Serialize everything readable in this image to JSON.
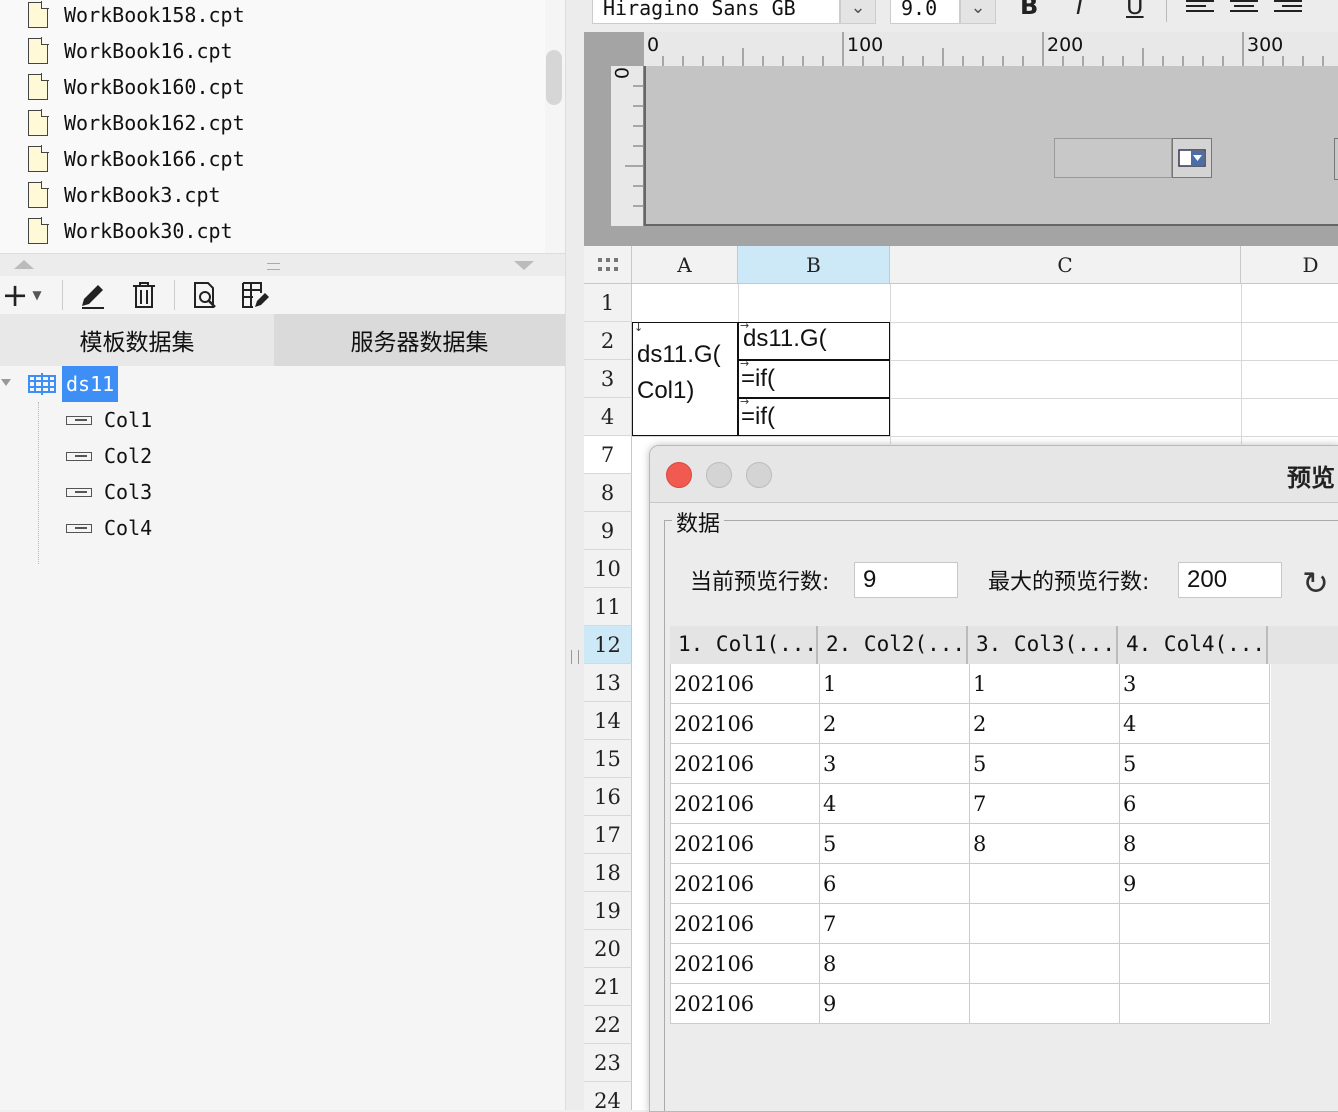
{
  "file_list": [
    "WorkBook158.cpt",
    "WorkBook16.cpt",
    "WorkBook160.cpt",
    "WorkBook162.cpt",
    "WorkBook166.cpt",
    "WorkBook3.cpt",
    "WorkBook30.cpt"
  ],
  "ds_tabs": {
    "template": "模板数据集",
    "server": "服务器数据集"
  },
  "tree": {
    "dataset": "ds11",
    "columns": [
      "Col1",
      "Col2",
      "Col3",
      "Col4"
    ]
  },
  "format_toolbar": {
    "font_name": "Hiragino Sans GB",
    "font_size": "9.0",
    "bold": "B",
    "italic": "I",
    "underline": "U"
  },
  "ruler": {
    "top": [
      "0",
      "100",
      "200",
      "300"
    ],
    "left": "0"
  },
  "sheet": {
    "columns": [
      "A",
      "B",
      "C",
      "D"
    ],
    "rows": [
      "1",
      "2",
      "3",
      "4",
      "7",
      "8",
      "9",
      "10",
      "11",
      "12",
      "13",
      "14",
      "15",
      "16",
      "17",
      "18",
      "19",
      "20",
      "21",
      "22",
      "23",
      "24"
    ],
    "cells": {
      "a2": "ds11.G(",
      "a2b": "Col1)",
      "b2": "ds11.G(",
      "b3": "=if(",
      "b4": "=if("
    }
  },
  "preview": {
    "title": "预览",
    "group": "数据",
    "current_rows_label": "当前预览行数:",
    "current_rows": "9",
    "max_rows_label": "最大的预览行数:",
    "max_rows": "200",
    "headers": [
      "1. Col1(...",
      "2. Col2(...",
      "3. Col3(...",
      "4. Col4(..."
    ],
    "rows": [
      [
        "202106",
        "1",
        "1",
        "3"
      ],
      [
        "202106",
        "2",
        "2",
        "4"
      ],
      [
        "202106",
        "3",
        "5",
        "5"
      ],
      [
        "202106",
        "4",
        "7",
        "6"
      ],
      [
        "202106",
        "5",
        "8",
        "8"
      ],
      [
        "202106",
        "6",
        "",
        "9"
      ],
      [
        "202106",
        "7",
        "",
        ""
      ],
      [
        "202106",
        "8",
        "",
        ""
      ],
      [
        "202106",
        "9",
        "",
        ""
      ]
    ]
  },
  "colors": {
    "selected": "#3d8ff5",
    "header_selected": "#cde8f7",
    "close": "#f05a50"
  }
}
